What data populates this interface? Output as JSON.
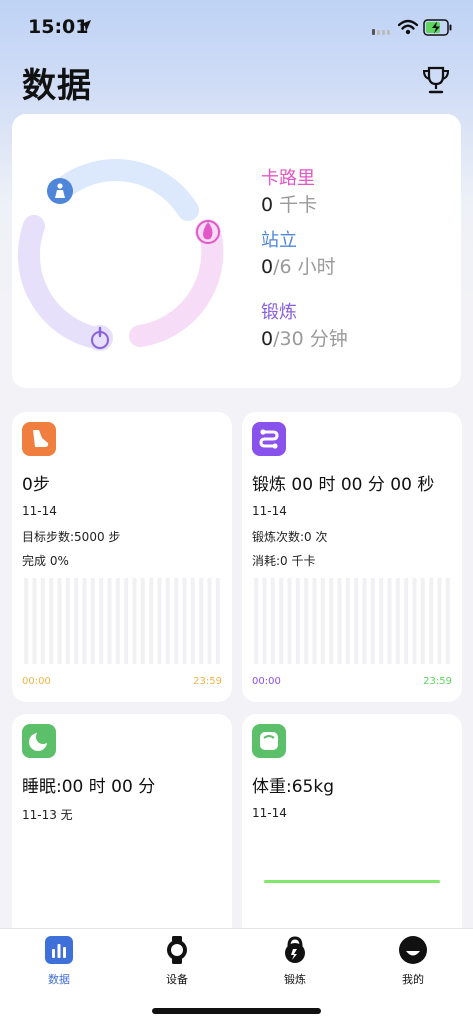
{
  "status": {
    "time": "15:01"
  },
  "header": {
    "title": "数据"
  },
  "rings": {
    "calories": {
      "label": "卡路里",
      "value": "0",
      "unit": " 千卡",
      "color": "#e357c7",
      "progress": 0
    },
    "stand": {
      "label": "站立",
      "value": "0",
      "unit": "/6 小时",
      "color": "#4f86d9",
      "progress": 0
    },
    "exercise": {
      "label": "锻炼",
      "value": "0",
      "unit": "/30 分钟",
      "color": "#8a5fe0",
      "progress": 0
    }
  },
  "steps": {
    "title": "0步",
    "date": "11-14",
    "goal": "目标步数:5000 步",
    "completion": "完成 0%",
    "axis_start": "00:00",
    "axis_end": "23:59",
    "icon_color": "#f07e3e",
    "axis_start_color": "#f0b54a",
    "axis_end_color": "#f0b54a"
  },
  "exercise_card": {
    "title": "锻炼 00 时 00 分 00 秒",
    "date": "11-14",
    "count": "锻炼次数:0 次",
    "burned": "消耗:0 千卡",
    "axis_start": "00:00",
    "axis_end": "23:59",
    "icon_color": "#8a52ec",
    "axis_start_color": "#8a52ec",
    "axis_end_color": "#5fd45f"
  },
  "sleep": {
    "title": "睡眠:00 时 00 分",
    "date_line": "11-13 无",
    "icon_color": "#5cc06a"
  },
  "weight": {
    "title": "体重:65kg",
    "date": "11-14",
    "icon_color": "#5cc06a",
    "line_color": "#7fe86a"
  },
  "tabbar": {
    "tabs": [
      {
        "label": "数据",
        "icon": "bar-chart-icon",
        "active": true
      },
      {
        "label": "设备",
        "icon": "watch-icon",
        "active": false
      },
      {
        "label": "锻炼",
        "icon": "kettlebell-icon",
        "active": false
      },
      {
        "label": "我的",
        "icon": "smiley-icon",
        "active": false
      }
    ],
    "active_color": "#3f6fd8"
  }
}
